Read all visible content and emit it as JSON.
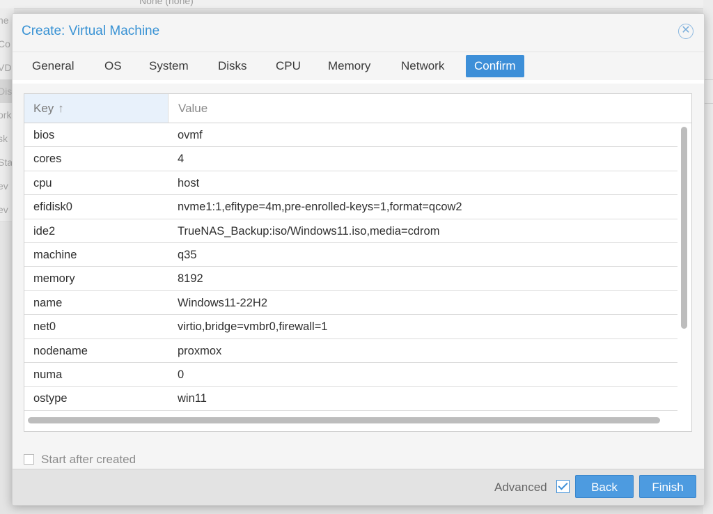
{
  "background": {
    "top_text": "None (none)",
    "left_fragments": [
      "ne",
      "Co",
      "VD",
      "Dis",
      "ork",
      "sk",
      "Sta",
      "ev",
      "ev"
    ]
  },
  "dialog": {
    "title": "Create: Virtual Machine",
    "close_icon": "close-icon"
  },
  "tabs": [
    {
      "label": "General"
    },
    {
      "label": "OS"
    },
    {
      "label": "System"
    },
    {
      "label": "Disks"
    },
    {
      "label": "CPU"
    },
    {
      "label": "Memory"
    },
    {
      "label": "Network"
    },
    {
      "label": "Confirm",
      "active": true
    }
  ],
  "grid": {
    "columns": {
      "key": "Key",
      "value": "Value"
    },
    "sort_icon": "arrow-up-icon",
    "rows": [
      {
        "key": "bios",
        "value": "ovmf"
      },
      {
        "key": "cores",
        "value": "4"
      },
      {
        "key": "cpu",
        "value": "host"
      },
      {
        "key": "efidisk0",
        "value": "nvme1:1,efitype=4m,pre-enrolled-keys=1,format=qcow2"
      },
      {
        "key": "ide2",
        "value": "TrueNAS_Backup:iso/Windows11.iso,media=cdrom"
      },
      {
        "key": "machine",
        "value": "q35"
      },
      {
        "key": "memory",
        "value": "8192"
      },
      {
        "key": "name",
        "value": "Windows11-22H2"
      },
      {
        "key": "net0",
        "value": "virtio,bridge=vmbr0,firewall=1"
      },
      {
        "key": "nodename",
        "value": "proxmox"
      },
      {
        "key": "numa",
        "value": "0"
      },
      {
        "key": "ostype",
        "value": "win11"
      }
    ]
  },
  "start_after_created": {
    "label": "Start after created",
    "checked": false
  },
  "footer": {
    "advanced_label": "Advanced",
    "advanced_checked": true,
    "back_label": "Back",
    "finish_label": "Finish"
  },
  "colors": {
    "accent": "#3d8fd8",
    "title": "#3892d4",
    "button": "#4d9be0"
  }
}
